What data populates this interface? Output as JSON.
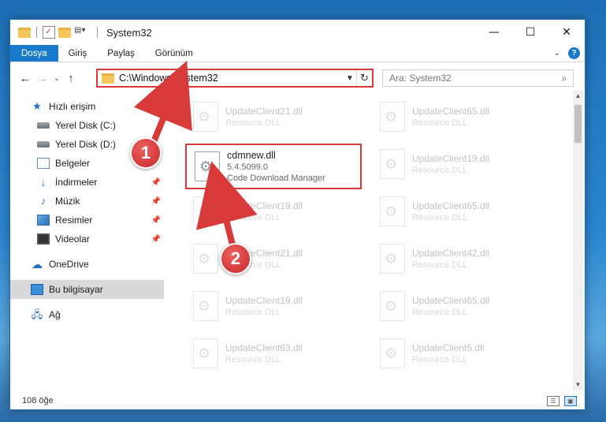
{
  "window": {
    "title": "System32",
    "controls": {
      "minimize": "—",
      "maximize": "☐",
      "close": "✕"
    }
  },
  "ribbon": {
    "tabs": [
      "Dosya",
      "Giriş",
      "Paylaş",
      "Görünüm"
    ],
    "help": "?"
  },
  "address": {
    "path": "C:\\Windows\\System32",
    "search_placeholder": "Ara: System32"
  },
  "sidebar": {
    "items": [
      {
        "label": "Hızlı erişim",
        "icon": "quick-access-star-icon"
      },
      {
        "label": "Yerel Disk (C:)",
        "icon": "drive-icon"
      },
      {
        "label": "Yerel Disk (D:)",
        "icon": "drive-icon"
      },
      {
        "label": "Belgeler",
        "icon": "documents-icon"
      },
      {
        "label": "İndirmeler",
        "icon": "downloads-icon"
      },
      {
        "label": "Müzik",
        "icon": "music-icon"
      },
      {
        "label": "Resimler",
        "icon": "pictures-icon"
      },
      {
        "label": "Videolar",
        "icon": "videos-icon"
      },
      {
        "label": "OneDrive",
        "icon": "onedrive-icon"
      },
      {
        "label": "Bu bilgisayar",
        "icon": "this-pc-icon"
      },
      {
        "label": "Ağ",
        "icon": "network-icon"
      }
    ]
  },
  "files": {
    "highlighted": {
      "name": "cdmnew.dll",
      "version": "5.4.5099.0",
      "description": "Code Download Manager"
    },
    "left": [
      {
        "name": "UpdateClient21.dll",
        "desc": "Resource DLL"
      },
      {
        "name": "UpdateClient19.dll",
        "desc": "Resource DLL"
      },
      {
        "name": "UpdateClient21.dll",
        "desc": "Resource DLL"
      },
      {
        "name": "UpdateClient19.dll",
        "desc": "Resource DLL"
      },
      {
        "name": "UpdateClient63.dll",
        "desc": "Resource DLL"
      }
    ],
    "right": [
      {
        "name": "UpdateClient65.dll",
        "desc": "Resource DLL"
      },
      {
        "name": "UpdateClient19.dll",
        "desc": "Resource DLL"
      },
      {
        "name": "UpdateClient65.dll",
        "desc": "Resource DLL"
      },
      {
        "name": "UpdateClient42.dll",
        "desc": "Resource DLL"
      },
      {
        "name": "UpdateClient65.dll",
        "desc": "Resource DLL"
      },
      {
        "name": "UpdateClient5.dll",
        "desc": "Resource DLL"
      }
    ]
  },
  "status": {
    "count": "108 öğe"
  },
  "annotations": {
    "step1": "1",
    "step2": "2",
    "color": "#d83a3a"
  }
}
